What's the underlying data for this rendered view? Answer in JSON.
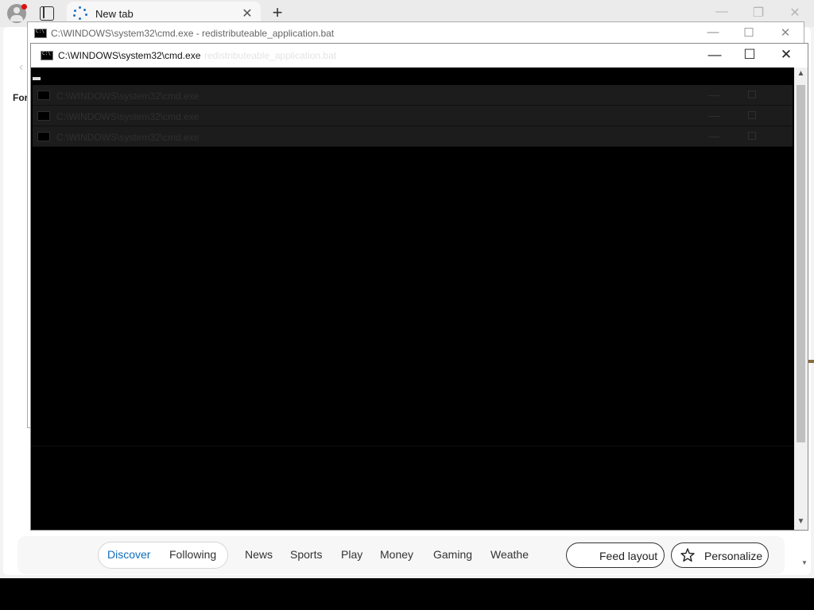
{
  "browser": {
    "tab_title": "New tab",
    "tab_close": "✕",
    "new_tab": "+",
    "minimize": "—",
    "restore": "❐",
    "close": "✕",
    "partial_label": "For",
    "feed": {
      "tabs": [
        "Discover",
        "Following"
      ],
      "active_tab": "Discover",
      "categories": [
        "News",
        "Sports",
        "Play",
        "Money",
        "Gaming",
        "Weathe"
      ],
      "feed_layout_label": "Feed layout",
      "personalize_label": "Personalize"
    }
  },
  "cmd_back": {
    "title": "C:\\WINDOWS\\system32\\cmd.exe - redistributeable_application.bat",
    "minimize": "—",
    "maximize": "☐",
    "close": "✕"
  },
  "cmd_front": {
    "title": "C:\\WINDOWS\\system32\\cmd.exe",
    "title_ghost": "redistributeable_application.bat",
    "minimize": "—",
    "maximize": "☐",
    "close": "✕",
    "ghost_rows": [
      "C:\\WINDOWS\\system32\\cmd.exe",
      "C:\\WINDOWS\\system32\\cmd.exe",
      "C:\\WINDOWS\\system32\\cmd.exe"
    ],
    "scroll_up": "▲",
    "scroll_down": "▼"
  },
  "colors": {
    "accent": "#0f6cbd",
    "console_bg": "#000000",
    "profile_badge": "#dd1111"
  }
}
